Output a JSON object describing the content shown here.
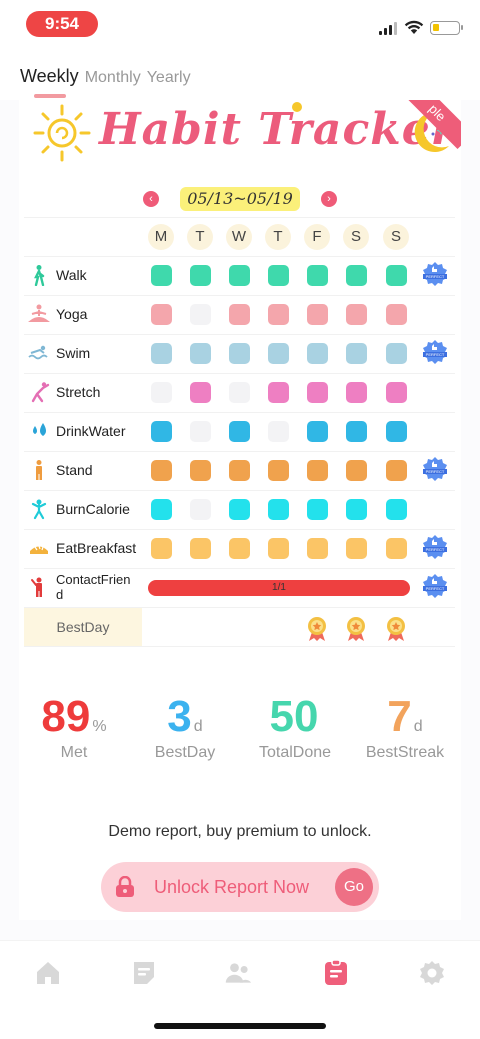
{
  "status_bar": {
    "time": "9:54"
  },
  "tabs": [
    {
      "label": "Weekly",
      "active": true
    },
    {
      "label": "Monthly",
      "active": false
    },
    {
      "label": "Yearly",
      "active": false
    }
  ],
  "banner": {
    "title": "Habit Tracker",
    "ribbon": "ple"
  },
  "week_nav": {
    "range": "05/13~05/19",
    "prev_icon": "chevron-left-icon",
    "next_icon": "chevron-right-icon"
  },
  "days": [
    "M",
    "T",
    "W",
    "T",
    "F",
    "S",
    "S"
  ],
  "habits": [
    {
      "name": "Walk",
      "icon": "walk-icon",
      "color": "#3fd9ac",
      "done": [
        1,
        1,
        1,
        1,
        1,
        1,
        1
      ],
      "perfect": true
    },
    {
      "name": "Yoga",
      "icon": "yoga-icon",
      "color": "#f4a6ac",
      "done": [
        1,
        0,
        1,
        1,
        1,
        1,
        1
      ],
      "perfect": false
    },
    {
      "name": "Swim",
      "icon": "swim-icon",
      "color": "#a9d2e2",
      "done": [
        1,
        1,
        1,
        1,
        1,
        1,
        1
      ],
      "perfect": true
    },
    {
      "name": "Stretch",
      "icon": "stretch-icon",
      "color": "#ee7fc2",
      "done": [
        0,
        1,
        0,
        1,
        1,
        1,
        1
      ],
      "perfect": false
    },
    {
      "name": "DrinkWater",
      "icon": "water-drops-icon",
      "color": "#30b7e5",
      "done": [
        1,
        0,
        1,
        0,
        1,
        1,
        1
      ],
      "perfect": false
    },
    {
      "name": "Stand",
      "icon": "stand-icon",
      "color": "#f0a24d",
      "done": [
        1,
        1,
        1,
        1,
        1,
        1,
        1
      ],
      "perfect": true
    },
    {
      "name": "BurnCalorie",
      "icon": "jump-icon",
      "color": "#23e1ec",
      "done": [
        1,
        0,
        1,
        1,
        1,
        1,
        1
      ],
      "perfect": false
    },
    {
      "name": "EatBreakfast",
      "icon": "bread-icon",
      "color": "#fbc566",
      "done": [
        1,
        1,
        1,
        1,
        1,
        1,
        1
      ],
      "perfect": true
    }
  ],
  "special_habit": {
    "name": "ContactFrien",
    "name_line2": "d",
    "icon": "person-wave-icon",
    "progress_text": "1/1",
    "perfect": true
  },
  "perfect_badge_label": "PERFECT",
  "best_day": {
    "label": "BestDay",
    "medal_days": [
      4,
      5,
      6
    ]
  },
  "stats": [
    {
      "value": "89",
      "unit": "%",
      "label": "Met",
      "color": "#ee3b3b"
    },
    {
      "value": "3",
      "unit": "d",
      "label": "BestDay",
      "color": "#3bb2ef"
    },
    {
      "value": "50",
      "unit": "",
      "label": "TotalDone",
      "color": "#46d6ad"
    },
    {
      "value": "7",
      "unit": "d",
      "label": "BestStreak",
      "color": "#f2a35c"
    }
  ],
  "demo_text": "Demo report, buy premium to unlock.",
  "unlock": {
    "label": "Unlock Report Now",
    "go": "Go"
  },
  "bottom_nav": [
    {
      "name": "home-icon",
      "active": false
    },
    {
      "name": "notes-icon",
      "active": false
    },
    {
      "name": "group-icon",
      "active": false
    },
    {
      "name": "report-icon",
      "active": true
    },
    {
      "name": "settings-icon",
      "active": false
    }
  ]
}
